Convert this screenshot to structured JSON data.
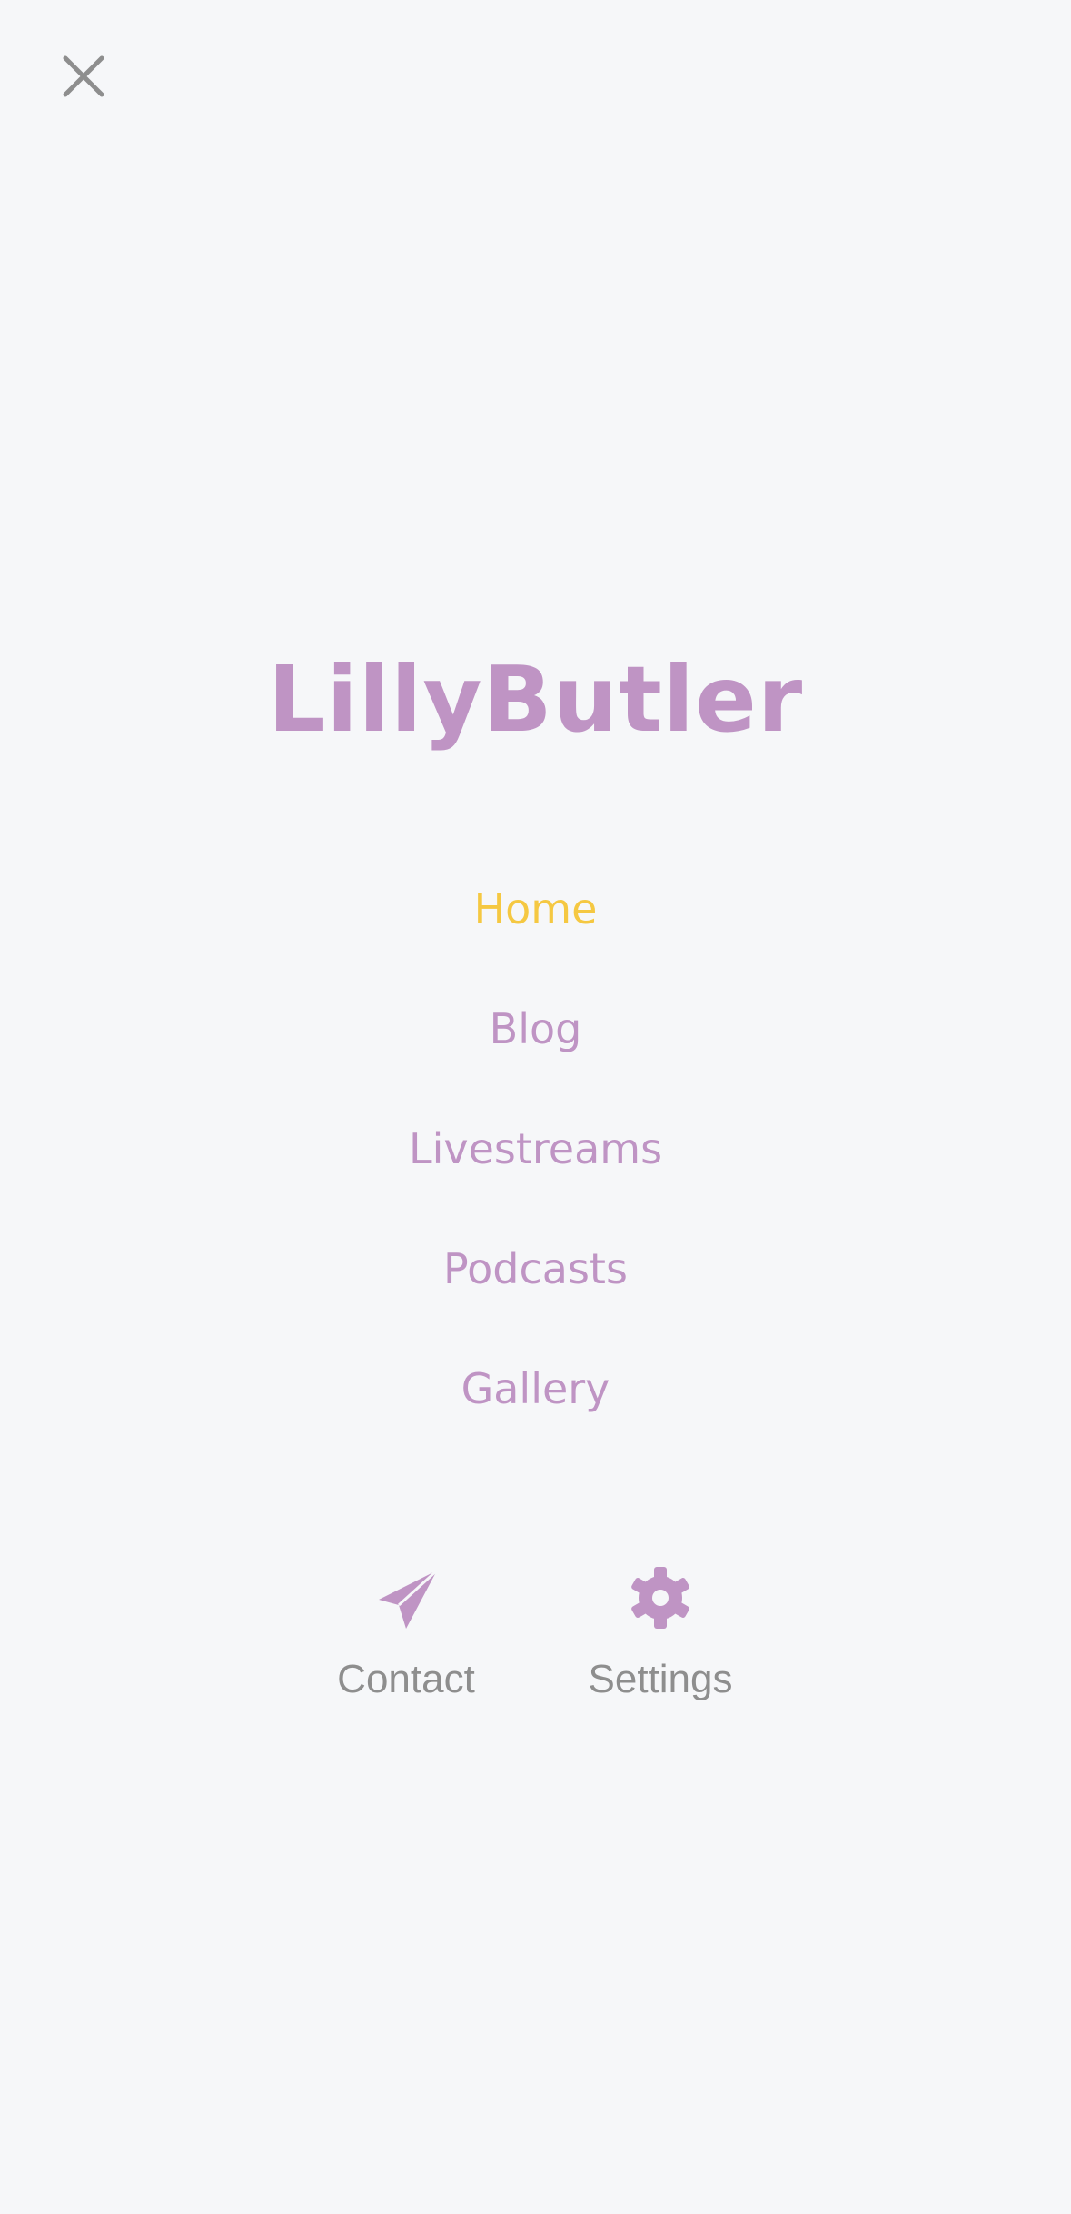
{
  "close": {
    "icon": "close-icon"
  },
  "brand": {
    "title": "LillyButler"
  },
  "menu": {
    "items": [
      {
        "label": "Home",
        "active": true
      },
      {
        "label": "Blog",
        "active": false
      },
      {
        "label": "Livestreams",
        "active": false
      },
      {
        "label": "Podcasts",
        "active": false
      },
      {
        "label": "Gallery",
        "active": false
      }
    ]
  },
  "actions": {
    "contact": {
      "label": "Contact",
      "icon": "paper-plane-icon"
    },
    "settings": {
      "label": "Settings",
      "icon": "gear-icon"
    }
  },
  "colors": {
    "background": "#f6f7f9",
    "accent": "#bf94c4",
    "active": "#f5c842",
    "muted": "#8e8e8e"
  }
}
